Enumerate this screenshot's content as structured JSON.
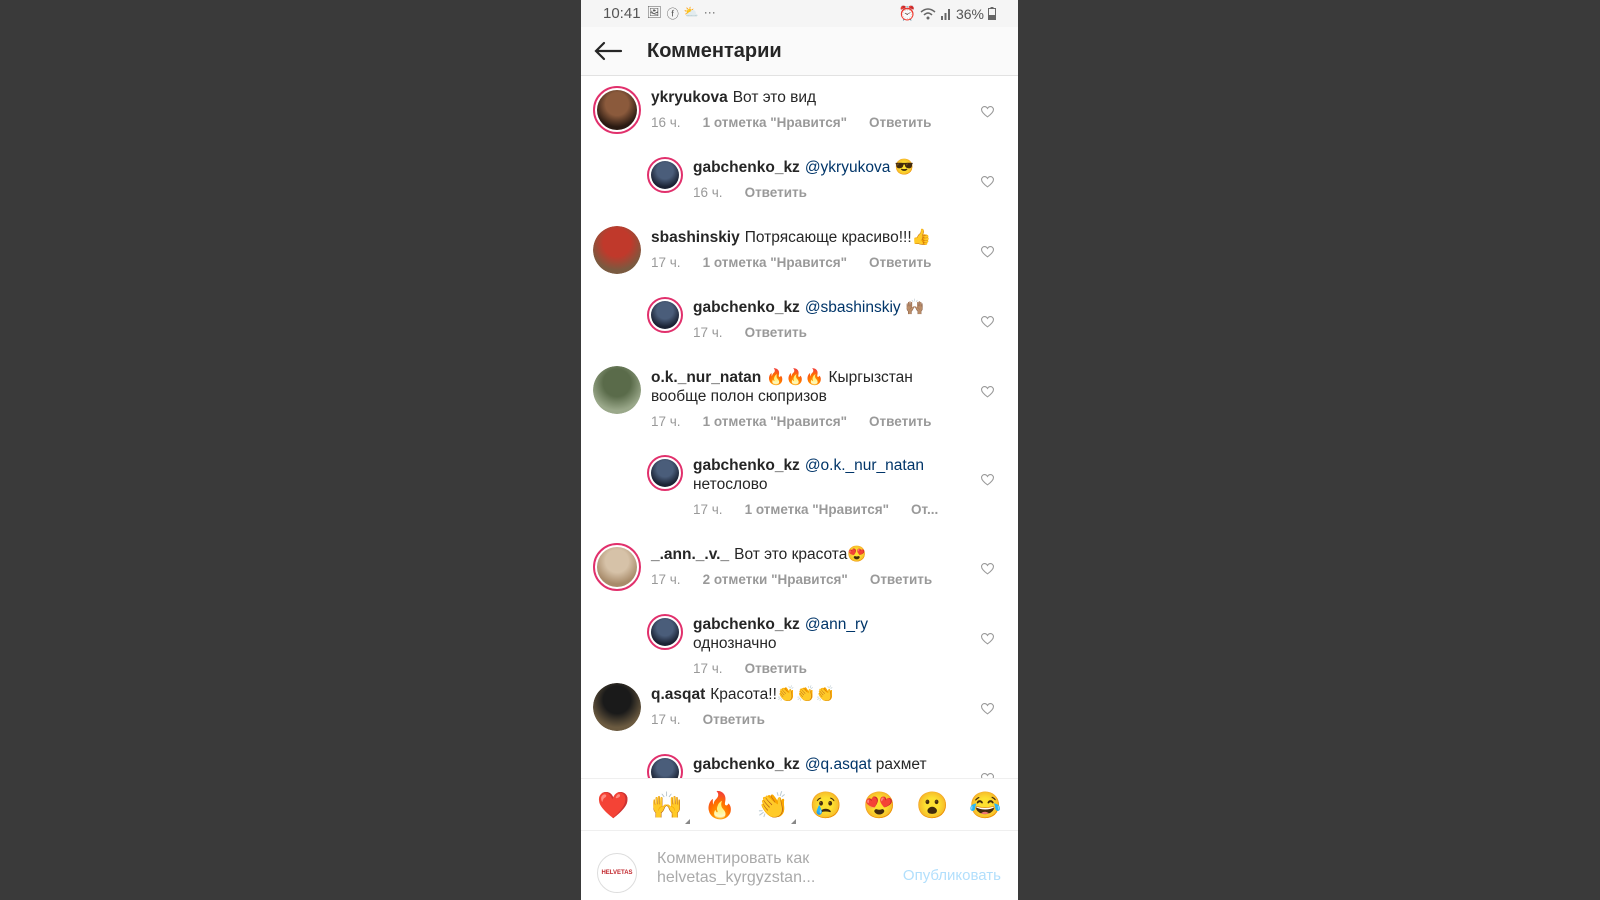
{
  "status": {
    "time": "10:41",
    "icons": [
      "🖼",
      "ⓕ",
      "⛅",
      "···"
    ],
    "alarm": "⏰",
    "battery": "36%"
  },
  "header": {
    "title": "Комментарии"
  },
  "comments": [
    {
      "user": "ykryukova",
      "text": "Вот это вид",
      "mention": "",
      "time": "16 ч.",
      "likes": "1 отметка \"Нравится\"",
      "reply": "Ответить"
    },
    {
      "user": "gabchenko_kz",
      "text": "😎",
      "mention": "@ykryukova",
      "time": "16 ч.",
      "likes": "",
      "reply": "Ответить"
    },
    {
      "user": "sbashinskiy",
      "text": "Потрясающе красиво!!!👍",
      "mention": "",
      "time": "17 ч.",
      "likes": "1 отметка \"Нравится\"",
      "reply": "Ответить"
    },
    {
      "user": "gabchenko_kz",
      "text": "🙌🏽",
      "mention": "@sbashinskiy",
      "time": "17 ч.",
      "likes": "",
      "reply": "Ответить"
    },
    {
      "user": "o.k._nur_natan",
      "text": "🔥🔥🔥 Кыргызстан вообще полон сюпризов",
      "mention": "",
      "time": "17 ч.",
      "likes": "1 отметка \"Нравится\"",
      "reply": "Ответить"
    },
    {
      "user": "gabchenko_kz",
      "text": "нетослово",
      "mention": "@o.k._nur_natan",
      "time": "17 ч.",
      "likes": "1 отметка \"Нравится\"",
      "reply": "От..."
    },
    {
      "user": "_.ann._.v._",
      "text": "Вот это красота😍",
      "mention": "",
      "time": "17 ч.",
      "likes": "2 отметки \"Нравится\"",
      "reply": "Ответить"
    },
    {
      "user": "gabchenko_kz",
      "text": "однозначно",
      "mention": "@ann_ry",
      "time": "17 ч.",
      "likes": "",
      "reply": "Ответить"
    },
    {
      "user": "q.asqat",
      "text": "Красота!!👏👏👏",
      "mention": "",
      "time": "17 ч.",
      "likes": "",
      "reply": "Ответить"
    },
    {
      "user": "gabchenko_kz",
      "text": "рахмет",
      "mention": "@q.asqat",
      "time": "",
      "likes": "",
      "reply": ""
    }
  ],
  "emojis": [
    "❤️",
    "🙌",
    "🔥",
    "👏",
    "😢",
    "😍",
    "😮",
    "😂"
  ],
  "input": {
    "placeholder": "Комментировать как helvetas_kyrgyzstan...",
    "publish": "Опубликовать",
    "avatar_text": "HELVETAS"
  }
}
